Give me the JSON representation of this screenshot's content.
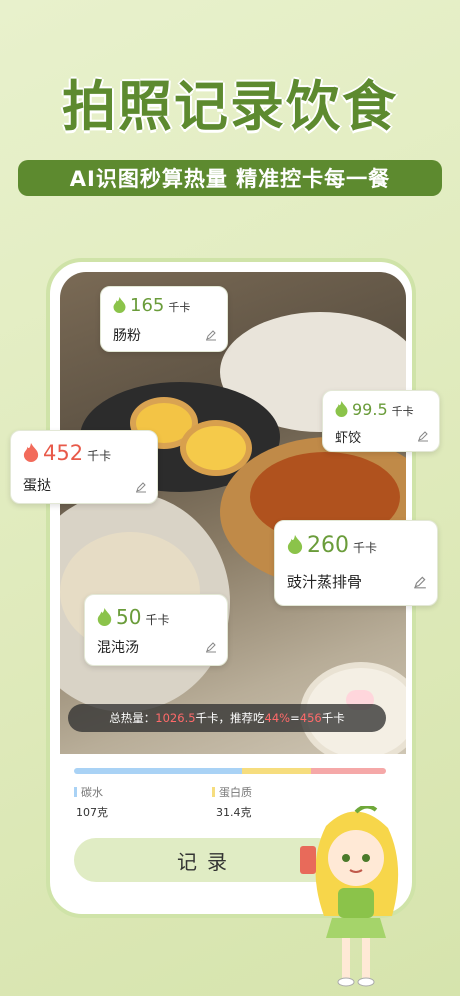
{
  "headline": "拍照记录饮食",
  "subtitle": "AI识图秒算热量 精准控卡每一餐",
  "colors": {
    "accent": "#5d8a2f",
    "normal_flame": "#8bc34a",
    "high_flame": "#f26b5b",
    "carb": "#a9d2f5",
    "protein": "#f6dd7e",
    "fat": "#f5a8a8"
  },
  "foods": [
    {
      "kcal": "165",
      "unit": "千卡",
      "name": "肠粉",
      "level": "normal"
    },
    {
      "kcal": "99.5",
      "unit": "千卡",
      "name": "虾饺",
      "level": "normal"
    },
    {
      "kcal": "452",
      "unit": "千卡",
      "name": "蛋挞",
      "level": "high"
    },
    {
      "kcal": "260",
      "unit": "千卡",
      "name": "豉汁蒸排骨",
      "level": "normal"
    },
    {
      "kcal": "50",
      "unit": "千卡",
      "name": "混沌汤",
      "level": "normal"
    }
  ],
  "summary": {
    "prefix": "总热量：",
    "total": "1026.5",
    "mid": "千卡，推荐吃",
    "percent": "44%",
    "eq": "=",
    "recommended": "456",
    "suffix": "千卡"
  },
  "macros": [
    {
      "label": "碳水",
      "value": "107克"
    },
    {
      "label": "蛋白质",
      "value": "31.4克"
    }
  ],
  "macro_split": [
    0.54,
    0.22,
    0.24
  ],
  "record_button": "记录"
}
